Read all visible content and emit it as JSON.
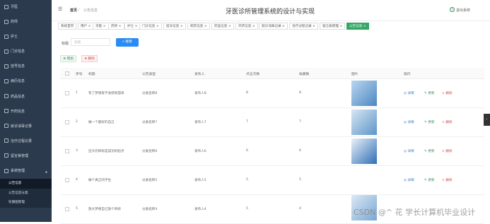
{
  "sidebar": {
    "items": [
      {
        "label": "牙医"
      },
      {
        "label": "药师"
      },
      {
        "label": "护士"
      },
      {
        "label": "门诊信息"
      },
      {
        "label": "挂号信息"
      },
      {
        "label": "病历信息"
      },
      {
        "label": "药品信息"
      },
      {
        "label": "开药信息"
      },
      {
        "label": "就诊消毒记录"
      },
      {
        "label": "治疗过程记录"
      },
      {
        "label": "留言板管理"
      },
      {
        "label": "系统管理",
        "expanded": true
      }
    ],
    "sub_items": [
      {
        "label": "公告信息",
        "active": true
      },
      {
        "label": "公告信息分类"
      },
      {
        "label": "轮播图管理"
      }
    ]
  },
  "header": {
    "fold_icon": "fold-icon",
    "breadcrumb_home": "首页",
    "breadcrumb_sep": "/",
    "breadcrumb_current": "公告信息",
    "title": "牙医诊所管理系统的设计与实现",
    "logout": "退出系统"
  },
  "tabs": [
    {
      "label": "系统首页"
    },
    {
      "label": "用户 ×"
    },
    {
      "label": "牙医 ×"
    },
    {
      "label": "药师 ×"
    },
    {
      "label": "护士 ×"
    },
    {
      "label": "门诊信息 ×"
    },
    {
      "label": "挂号信息 ×"
    },
    {
      "label": "病历信息 ×"
    },
    {
      "label": "药品信息 ×"
    },
    {
      "label": "开药信息 ×"
    },
    {
      "label": "就诊消毒记录 ×"
    },
    {
      "label": "治疗过程记录 ×"
    },
    {
      "label": "留言板管理 ×"
    },
    {
      "label": "公告信息 ×",
      "active": true
    }
  ],
  "search": {
    "label": "标题",
    "placeholder": "标题",
    "button": "搜索"
  },
  "toolbar": {
    "add": "增加",
    "delete": "删除"
  },
  "table": {
    "headers": [
      "序号",
      "标题",
      "公告类型",
      "发布人",
      "点击次数",
      "收藏数",
      "图片",
      "操作"
    ],
    "rows": [
      {
        "index": "1",
        "title": "有了梦想就不会感到孤单",
        "category": "分类名称8",
        "publisher": "发布人8",
        "clicks": "8",
        "favorites": "8"
      },
      {
        "index": "2",
        "title": "做一个最好的自己",
        "category": "分类名称7",
        "publisher": "发布人7",
        "clicks": "7",
        "favorites": "7"
      },
      {
        "index": "3",
        "title": "迈大的目标是成功的起点",
        "category": "分类名称6",
        "publisher": "发布人6",
        "clicks": "6",
        "favorites": "6"
      },
      {
        "index": "4",
        "title": "做个真正的学生",
        "category": "分类名称5",
        "publisher": "发布人5",
        "clicks": "5",
        "favorites": "5"
      },
      {
        "index": "5",
        "title": "放大梦想自己放个目标",
        "category": "分类名称4",
        "publisher": "发布人4",
        "clicks": "5",
        "favorites": "4"
      }
    ],
    "actions": {
      "detail": "详情",
      "edit": "更新",
      "delete": "删除"
    }
  },
  "watermark": "CSDN @^ 花 学长计算机毕业设计"
}
